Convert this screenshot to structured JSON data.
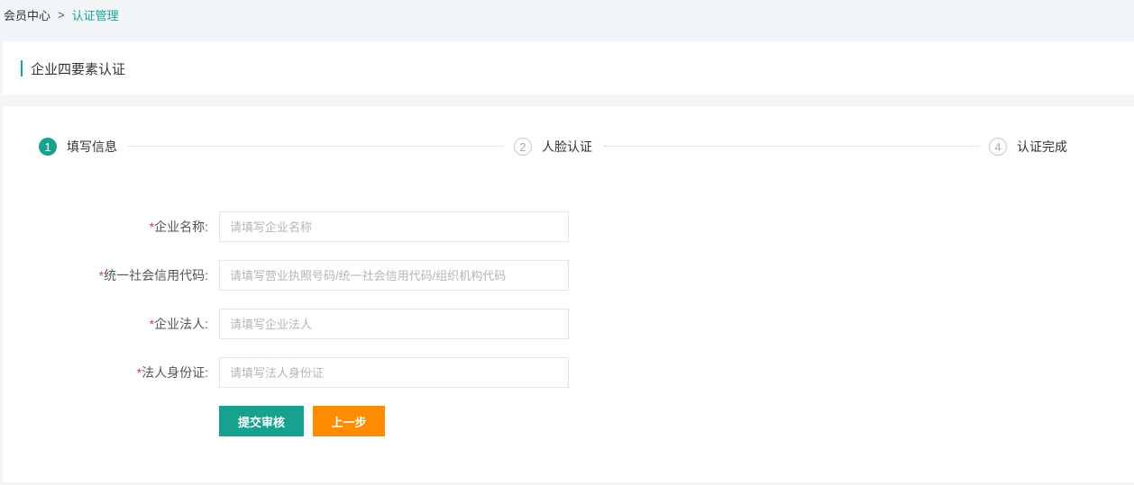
{
  "breadcrumb": {
    "home": "会员中心",
    "separator": ">",
    "current": "认证管理"
  },
  "page": {
    "title": "企业四要素认证"
  },
  "steps": [
    {
      "number": "1",
      "label": "填写信息",
      "state": "active"
    },
    {
      "number": "2",
      "label": "人脸认证",
      "state": "inactive"
    },
    {
      "number": "4",
      "label": "认证完成",
      "state": "inactive"
    }
  ],
  "form": {
    "company_name": {
      "required": "*",
      "label": "企业名称:",
      "placeholder": "请填写企业名称",
      "value": ""
    },
    "credit_code": {
      "required": "*",
      "label": "统一社会信用代码:",
      "placeholder": "请填写营业执照号码/统一社会信用代码/组织机构代码",
      "value": ""
    },
    "legal_person": {
      "required": "*",
      "label": "企业法人:",
      "placeholder": "请填写企业法人",
      "value": ""
    },
    "legal_id": {
      "required": "*",
      "label": "法人身份证:",
      "placeholder": "请填写法人身份证",
      "value": ""
    }
  },
  "buttons": {
    "submit": "提交审核",
    "prev": "上一步"
  },
  "colors": {
    "accent": "#17a18f",
    "secondary_button": "#ff8c00",
    "required_star": "#e4393c",
    "page_background": "#f2f6f8"
  }
}
